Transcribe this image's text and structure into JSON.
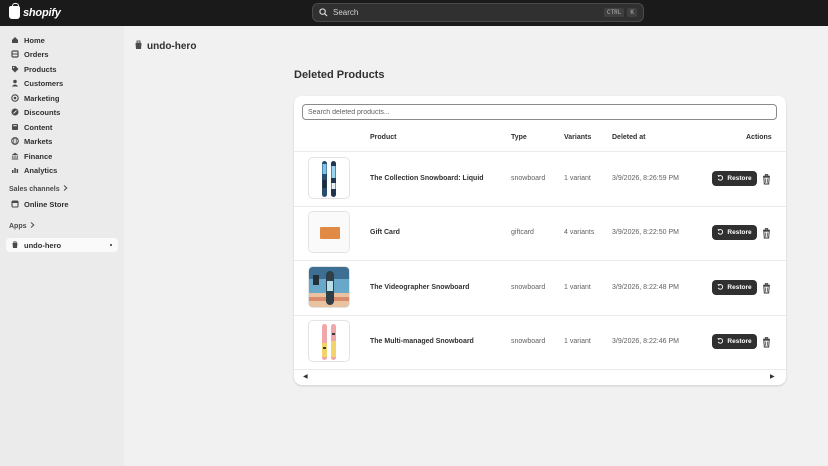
{
  "topbar": {
    "logo_text": "shopify",
    "search_placeholder": "Search",
    "shortcut_keys": [
      "CTRL",
      "K"
    ]
  },
  "sidebar": {
    "items": [
      {
        "label": "Home",
        "icon": "home-icon"
      },
      {
        "label": "Orders",
        "icon": "orders-icon"
      },
      {
        "label": "Products",
        "icon": "tag-icon"
      },
      {
        "label": "Customers",
        "icon": "person-icon"
      },
      {
        "label": "Marketing",
        "icon": "target-icon"
      },
      {
        "label": "Discounts",
        "icon": "discount-icon"
      },
      {
        "label": "Content",
        "icon": "content-icon"
      },
      {
        "label": "Markets",
        "icon": "globe-icon"
      },
      {
        "label": "Finance",
        "icon": "bank-icon"
      },
      {
        "label": "Analytics",
        "icon": "chart-icon"
      }
    ],
    "sales_channels_label": "Sales channels",
    "online_store_label": "Online Store",
    "apps_label": "Apps",
    "app_item_label": "undo-hero"
  },
  "page": {
    "app_title": "undo-hero",
    "section_title": "Deleted Products",
    "search_placeholder": "Search deleted products..."
  },
  "table": {
    "columns": [
      "Product",
      "Type",
      "Variants",
      "Deleted at",
      "Actions"
    ],
    "restore_label": "Restore",
    "rows": [
      {
        "name": "The Collection Snowboard: Liquid",
        "type": "snowboard",
        "variants": "1 variant",
        "deleted_at": "3/9/2026, 8:26:59 PM"
      },
      {
        "name": "Gift Card",
        "type": "giftcard",
        "variants": "4 variants",
        "deleted_at": "3/9/2026, 8:22:50 PM"
      },
      {
        "name": "The Videographer Snowboard",
        "type": "snowboard",
        "variants": "1 variant",
        "deleted_at": "3/9/2026, 8:22:48 PM"
      },
      {
        "name": "The Multi-managed Snowboard",
        "type": "snowboard",
        "variants": "1 variant",
        "deleted_at": "3/9/2026, 8:22:46 PM"
      }
    ]
  },
  "colors": {
    "topbar_bg": "#1a1a1a",
    "button_bg": "#303030",
    "page_bg": "#f1f1f1",
    "sidebar_bg": "#ebebeb"
  }
}
